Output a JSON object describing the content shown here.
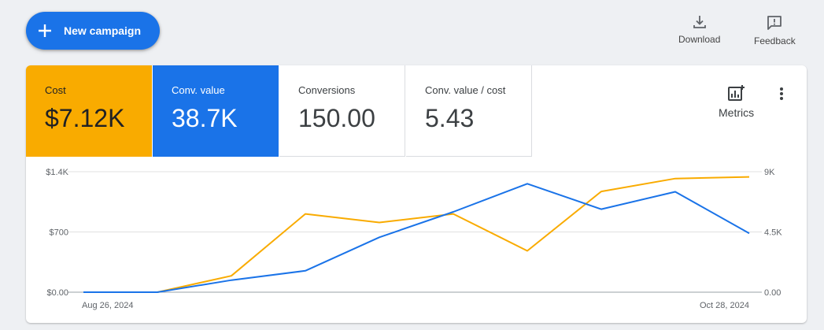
{
  "toolbar": {
    "new_campaign_label": "New campaign",
    "download_label": "Download",
    "feedback_label": "Feedback"
  },
  "metric_tiles": [
    {
      "label": "Cost",
      "value": "$7.12K",
      "color": "#f9ab00"
    },
    {
      "label": "Conv. value",
      "value": "38.7K",
      "color": "#1a73e8"
    },
    {
      "label": "Conversions",
      "value": "150.00"
    },
    {
      "label": "Conv. value / cost",
      "value": "5.43"
    }
  ],
  "metrics_button_label": "Metrics",
  "icons": [
    "plus-icon",
    "download-icon",
    "feedback-icon",
    "metrics-icon",
    "more-vert-icon"
  ],
  "chart_data": {
    "type": "line",
    "x_labels": [
      "Aug 26, 2024",
      "Oct 28, 2024"
    ],
    "left_axis": {
      "ticks": [
        "$0.00",
        "$700",
        "$1.4K"
      ],
      "range": [
        0,
        1400
      ]
    },
    "right_axis": {
      "ticks": [
        "0.00",
        "4.5K",
        "9K"
      ],
      "range": [
        0,
        9000
      ]
    },
    "grid": true,
    "series": [
      {
        "name": "Cost",
        "axis": "left",
        "color": "#f9ab00",
        "values": [
          0,
          0,
          190,
          910,
          810,
          910,
          480,
          1170,
          1320,
          1340
        ]
      },
      {
        "name": "Conv. value",
        "axis": "right",
        "color": "#1a73e8",
        "values": [
          0,
          0,
          900,
          1600,
          4100,
          6000,
          8100,
          6200,
          7500,
          4400
        ]
      }
    ]
  }
}
